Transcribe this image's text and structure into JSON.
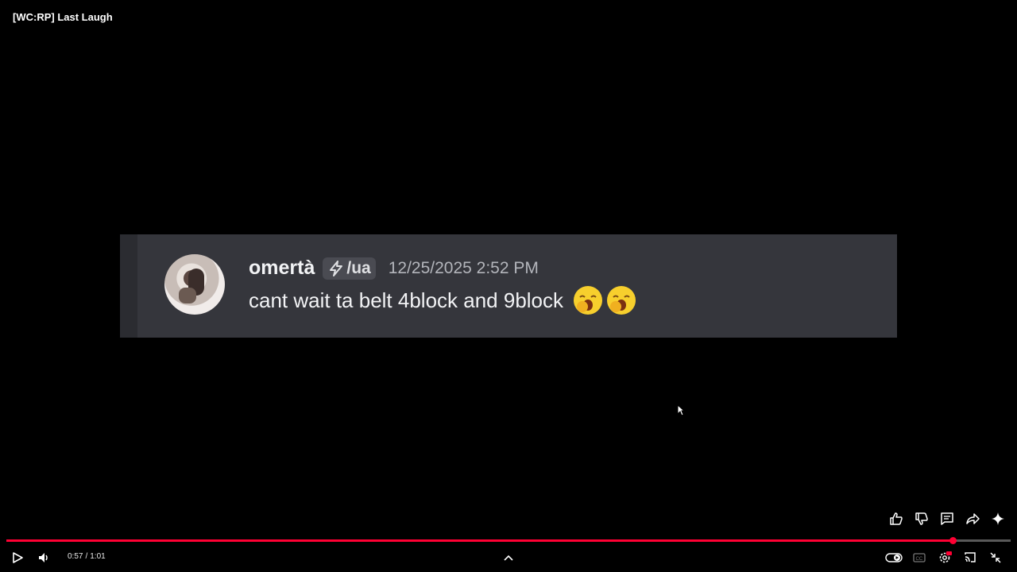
{
  "video": {
    "title": "[WC:RP] Last Laugh"
  },
  "message": {
    "username": "omertà",
    "tag_label": "/ua",
    "tag_icon": "lightning-icon",
    "timestamp": "12/25/2025 2:52 PM",
    "text": "cant wait ta belt 4block and 9block",
    "emojis": [
      "yawning-face",
      "yawning-face"
    ]
  },
  "playback": {
    "current_time": "0:57",
    "separator": "/",
    "duration": "1:01",
    "progress_fraction": 0.942
  },
  "actions": [
    "like-icon",
    "dislike-icon",
    "comment-icon",
    "share-icon",
    "sparkle-icon"
  ],
  "controls": {
    "left": [
      "play-icon",
      "volume-icon"
    ],
    "center": [
      "chevron-up-icon"
    ],
    "right": [
      "autoplay-toggle",
      "captions-icon",
      "settings-hd-icon",
      "cast-icon",
      "exit-fullscreen-icon"
    ]
  },
  "colors": {
    "accent": "#ff0033",
    "card_background": "#35363c"
  }
}
